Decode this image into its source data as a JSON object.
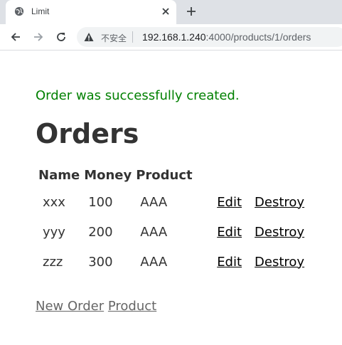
{
  "browser": {
    "tab_title": "Limit",
    "insecure_label": "不安全",
    "url_host": "192.168.1.240",
    "url_path": ":4000/products/1/orders",
    "icons": [
      "globe-icon",
      "close-icon",
      "plus-icon",
      "back-icon",
      "forward-icon",
      "reload-icon",
      "warning-icon"
    ]
  },
  "page": {
    "notice": "Order was successfully created.",
    "notice_color": "#008000",
    "title": "Orders"
  },
  "table": {
    "headers": [
      "Name",
      "Money",
      "Product"
    ],
    "rows": [
      {
        "name": "xxx",
        "money": "100",
        "product": "AAA",
        "edit": "Edit",
        "destroy": "Destroy"
      },
      {
        "name": "yyy",
        "money": "200",
        "product": "AAA",
        "edit": "Edit",
        "destroy": "Destroy"
      },
      {
        "name": "zzz",
        "money": "300",
        "product": "AAA",
        "edit": "Edit",
        "destroy": "Destroy"
      }
    ]
  },
  "footer": {
    "new_order": "New Order",
    "product": "Product"
  }
}
